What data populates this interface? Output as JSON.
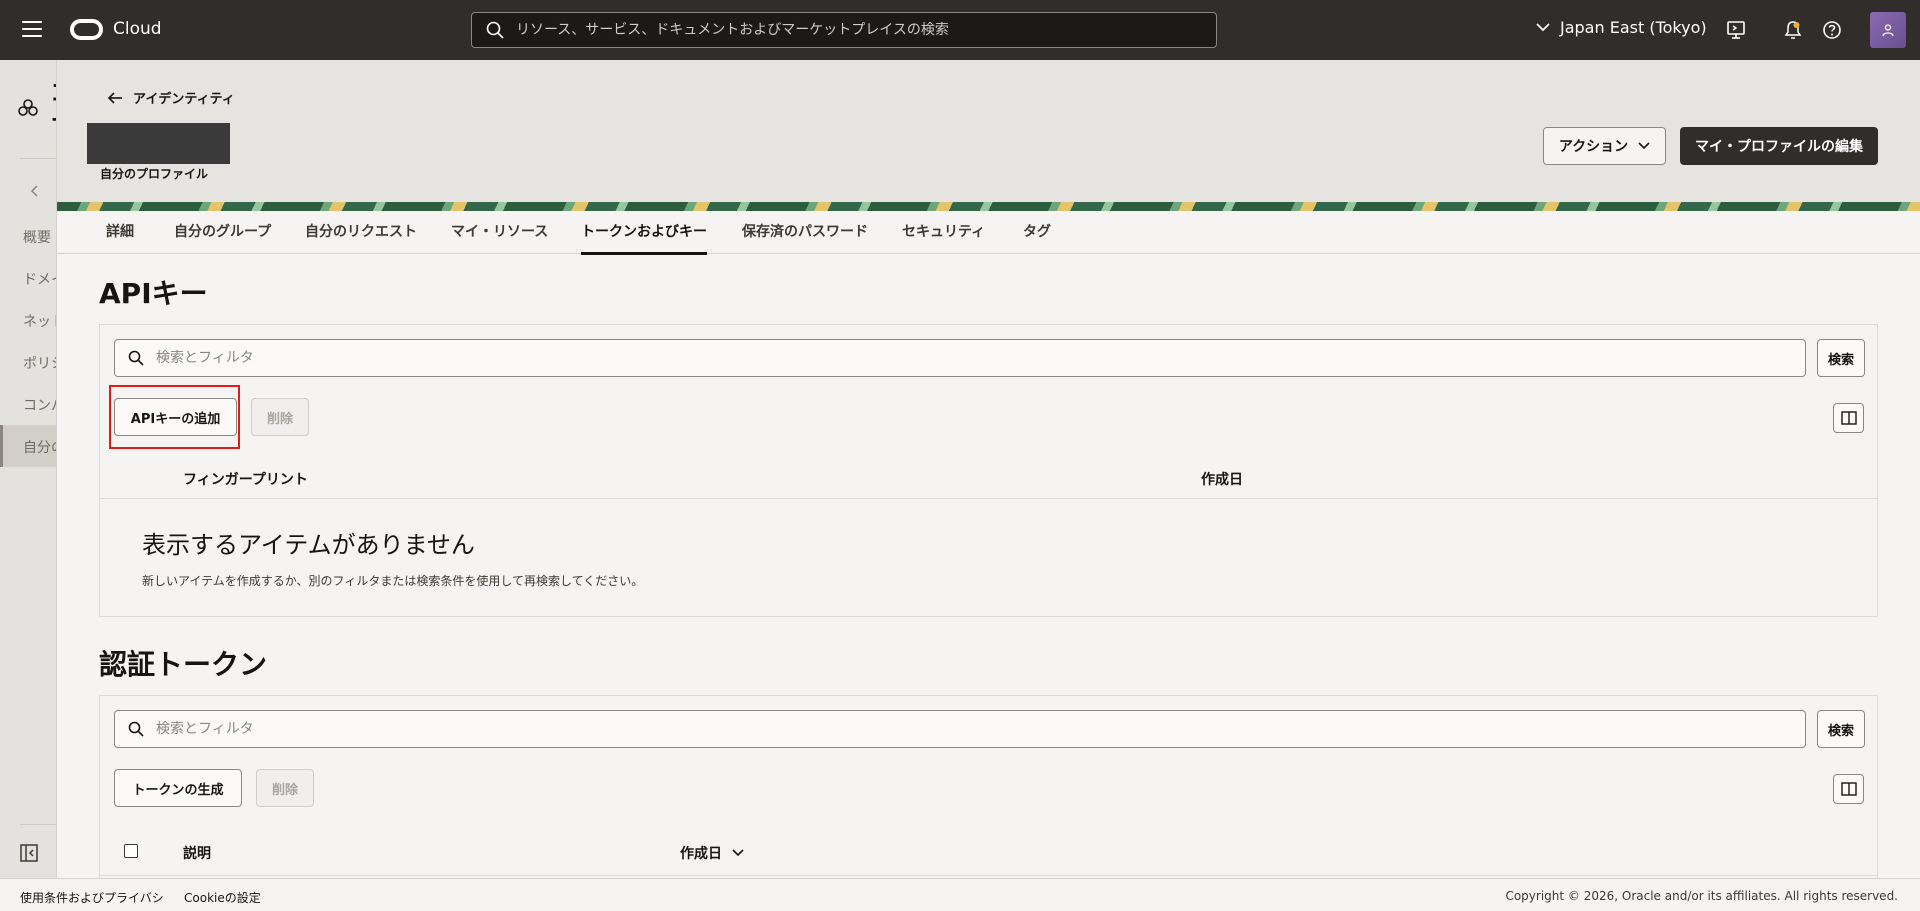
{
  "topbar": {
    "brand": "Cloud",
    "search_placeholder": "リソース、サービス、ドキュメントおよびマーケットプレイスの検索",
    "region": "Japan East (Tokyo)"
  },
  "leftrail": {
    "title": "コ\n+",
    "items": [
      "概要",
      "ドメイン",
      "ネットワーク",
      "ポリシー",
      "コンパートメント",
      "自分のプロファイル"
    ]
  },
  "header": {
    "back_label": "アイデンティティ",
    "profile_label": "自分のプロファイル",
    "action_label": "アクション",
    "edit_label": "マイ・プロファイルの編集"
  },
  "tabs": [
    "詳細",
    "自分のグループ",
    "自分のリクエスト",
    "マイ・リソース",
    "トークンおよびキー",
    "保存済のパスワード",
    "セキュリティ",
    "タグ"
  ],
  "api_keys": {
    "title": "APIキー",
    "filter_placeholder": "検索とフィルタ",
    "search_label": "検索",
    "add_label": "APIキーの追加",
    "delete_label": "削除",
    "columns": [
      "フィンガープリント",
      "作成日"
    ],
    "empty_title": "表示するアイテムがありません",
    "empty_sub": "新しいアイテムを作成するか、別のフィルタまたは検索条件を使用して再検索してください。"
  },
  "auth_tokens": {
    "title": "認証トークン",
    "filter_placeholder": "検索とフィルタ",
    "search_label": "検索",
    "generate_label": "トークンの生成",
    "delete_label": "削除",
    "columns": [
      "説明",
      "作成日"
    ]
  },
  "footer": {
    "terms": "使用条件およびプライバシ",
    "cookies": "Cookieの設定",
    "copyright": "Copyright © 2026, Oracle and/or its affiliates. All rights reserved."
  },
  "colors": {
    "topbar_bg": "#312d2a",
    "highlight": "#e01b1b",
    "primary_button": "#312d2a"
  }
}
